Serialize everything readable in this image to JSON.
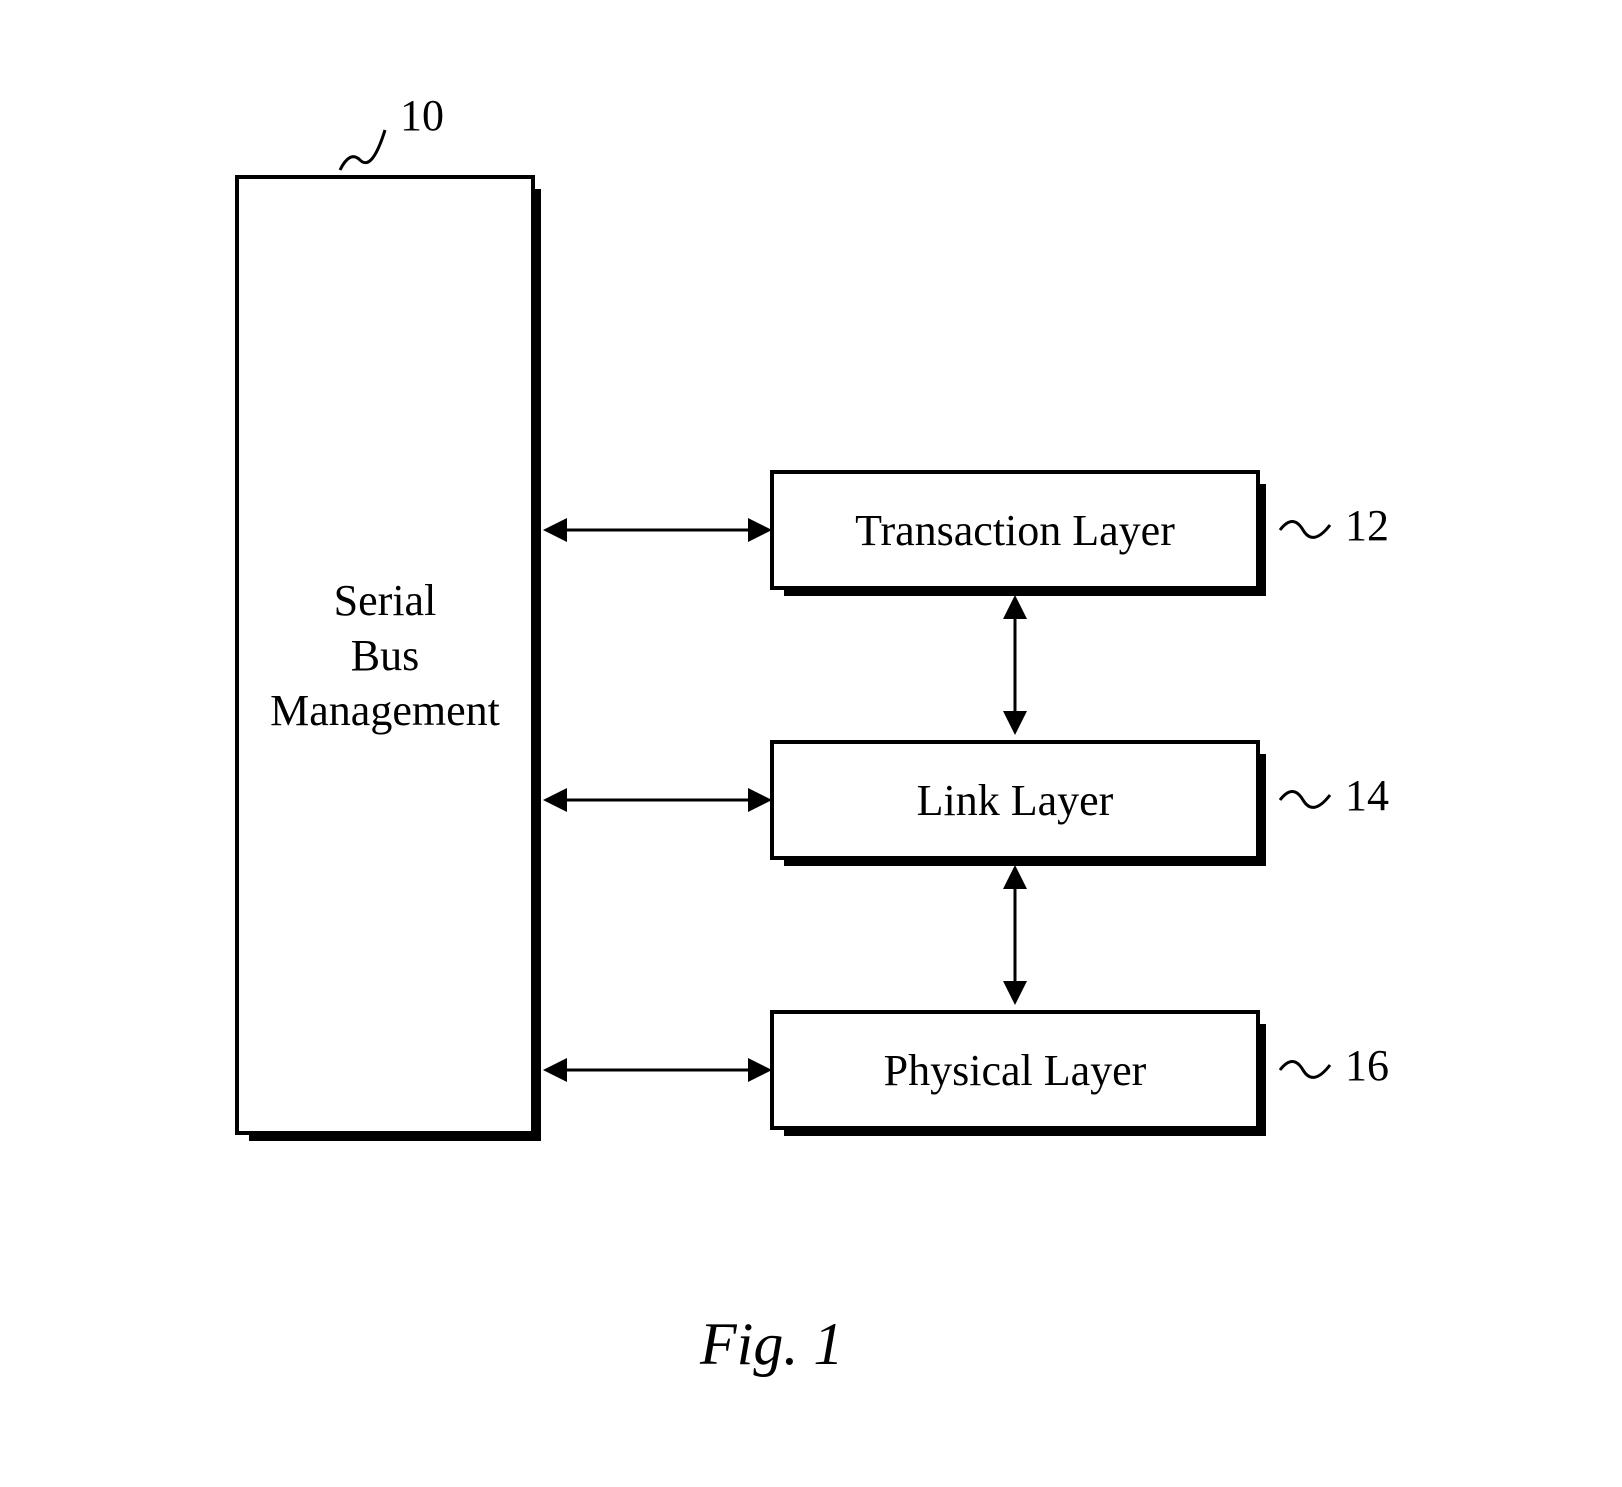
{
  "boxes": {
    "serial_bus_management": {
      "label": "Serial\nBus\nManagement",
      "ref": "10"
    },
    "transaction_layer": {
      "label": "Transaction Layer",
      "ref": "12"
    },
    "link_layer": {
      "label": "Link Layer",
      "ref": "14"
    },
    "physical_layer": {
      "label": "Physical Layer",
      "ref": "16"
    }
  },
  "caption": "Fig. 1"
}
